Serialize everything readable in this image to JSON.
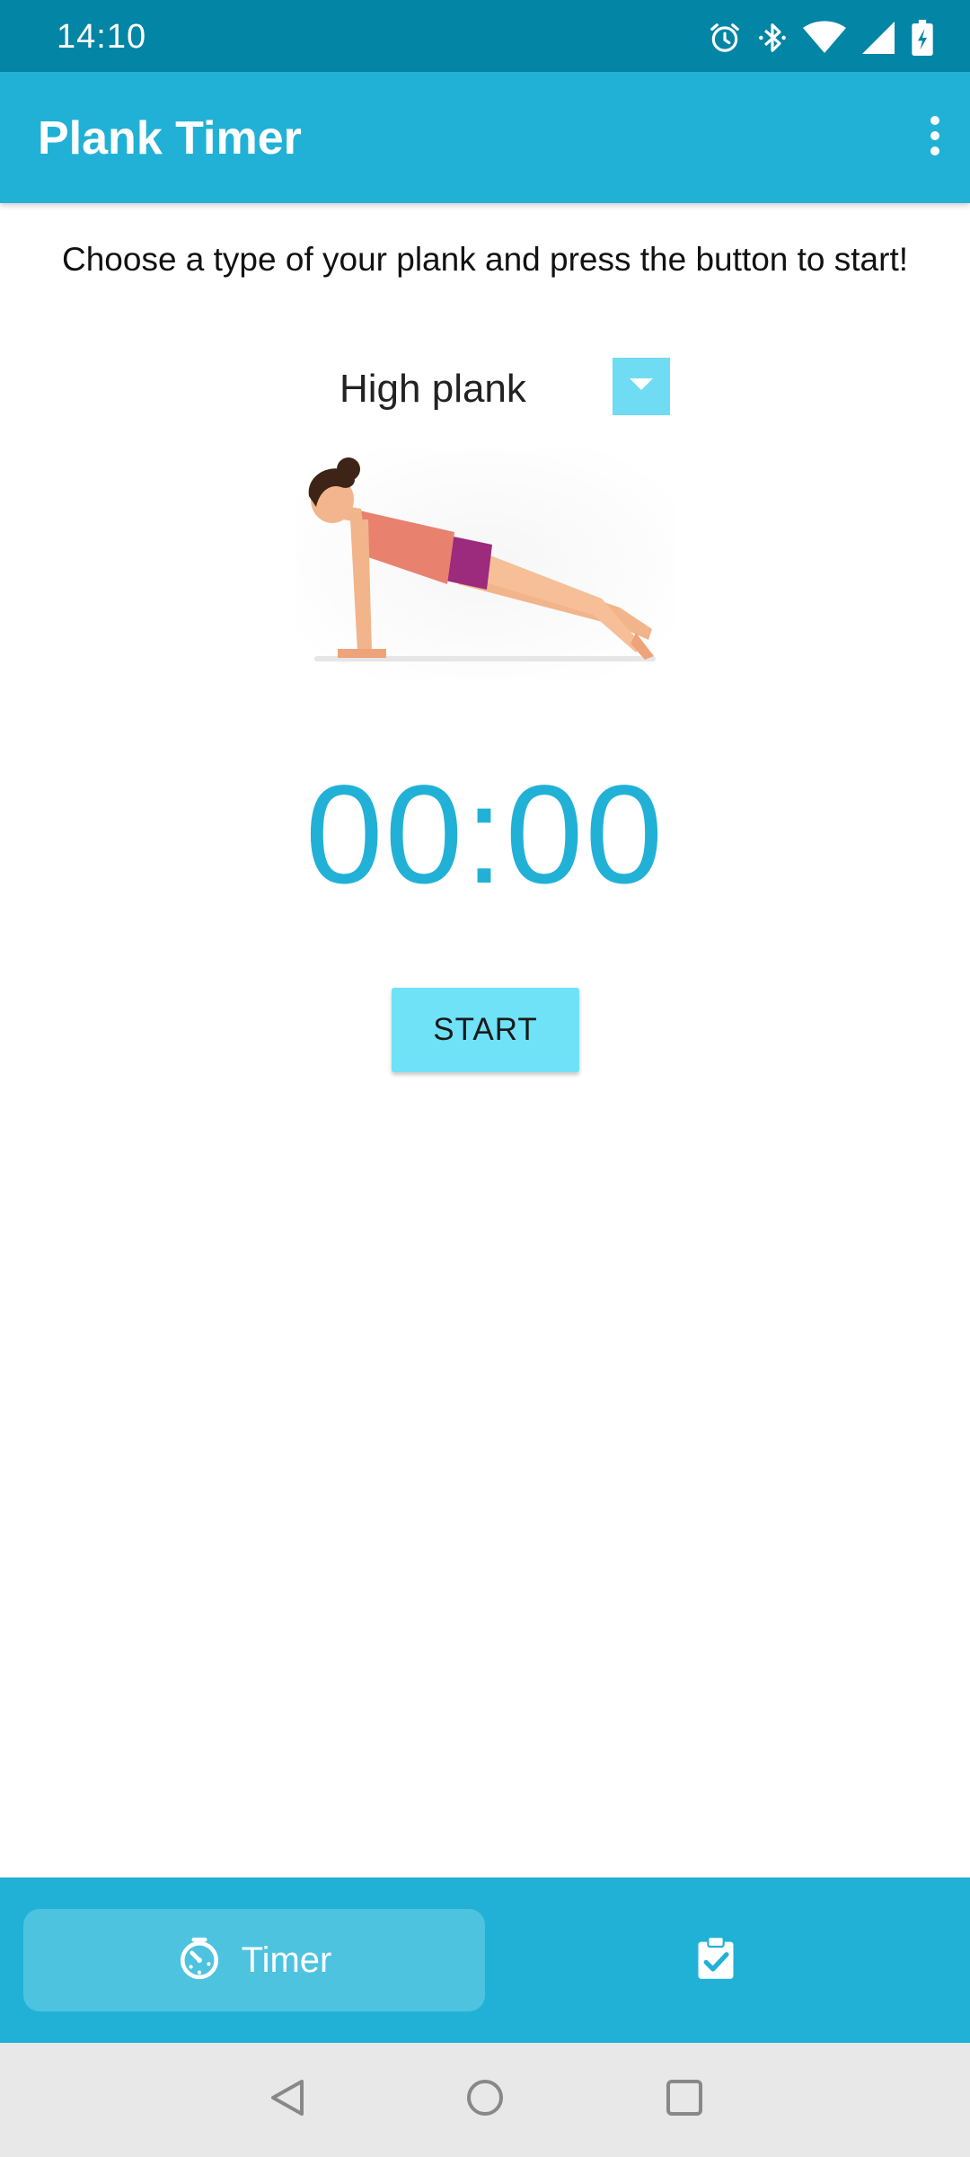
{
  "status_bar": {
    "time": "14:10",
    "icons": [
      "alarm-icon",
      "bluetooth-icon",
      "wifi-icon",
      "signal-icon",
      "battery-charging-icon"
    ]
  },
  "app_bar": {
    "title": "Plank Timer",
    "menu_icon": "more-vert-icon"
  },
  "main": {
    "instructions": "Choose a type of your plank and press the button to start!",
    "plank_type": {
      "selected": "High plank"
    },
    "timer": "00:00",
    "start_label": "START"
  },
  "bottom_nav": {
    "items": [
      {
        "label": "Timer",
        "icon": "stopwatch-icon",
        "active": true
      },
      {
        "label": "",
        "icon": "clipboard-check-icon",
        "active": false
      }
    ]
  },
  "system_nav": [
    "back-icon",
    "home-icon",
    "recents-icon"
  ],
  "colors": {
    "status_bar": "#0385a5",
    "primary": "#22b1d6",
    "accent": "#6fe2f8",
    "nav_active": "#4dc3e0",
    "system_nav": "#e8e8e8"
  }
}
